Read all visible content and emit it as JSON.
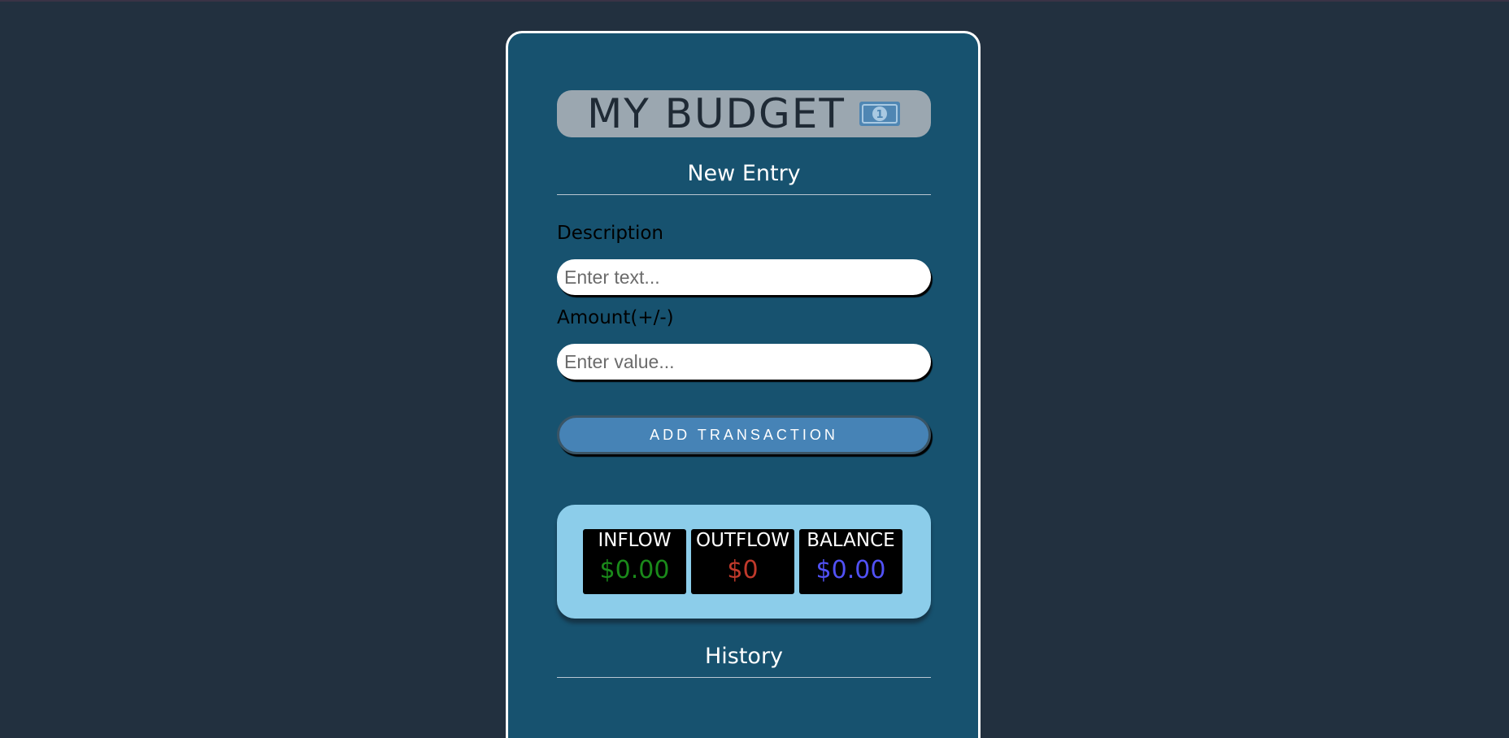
{
  "header": {
    "title": "MY BUDGET",
    "icon": "dollar-bill-icon"
  },
  "new_entry": {
    "heading": "New Entry",
    "description_label": "Description",
    "description_placeholder": "Enter text...",
    "description_value": "",
    "amount_label": "Amount(+/-)",
    "amount_placeholder": "Enter value...",
    "amount_value": "",
    "add_button_label": "ADD TRANSACTION"
  },
  "summary": {
    "inflow_label": "INFLOW",
    "inflow_value": "$0.00",
    "outflow_label": "OUTFLOW",
    "outflow_value": "$0",
    "balance_label": "BALANCE",
    "balance_value": "$0.00"
  },
  "history": {
    "heading": "History"
  },
  "colors": {
    "page_background": "#22303f",
    "card_background": "#17526f",
    "title_pill": "#9ba7b0",
    "button": "#4683b6",
    "summary_panel": "#8ccdea",
    "inflow": "#1a8a1a",
    "outflow": "#c0392b",
    "balance": "#5151f5"
  }
}
